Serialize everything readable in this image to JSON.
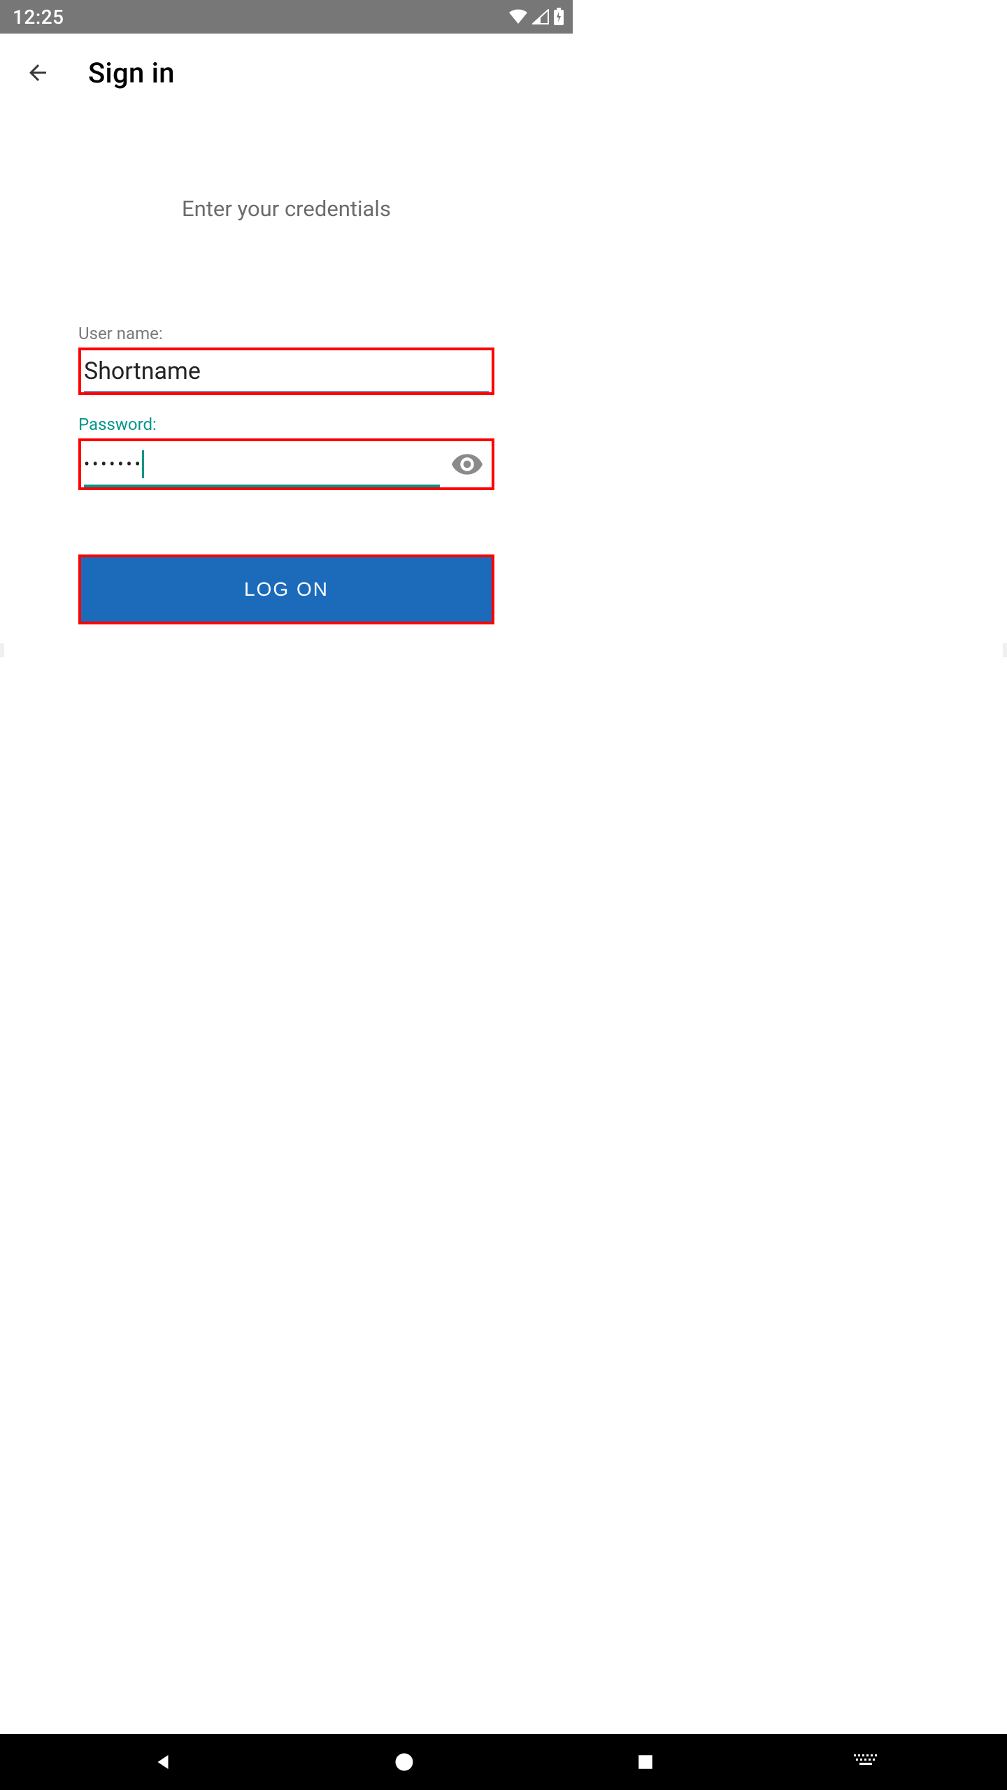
{
  "status": {
    "time": "12:25"
  },
  "appbar": {
    "title": "Sign in"
  },
  "main": {
    "subtitle": "Enter your credentials",
    "username_label": "User name:",
    "username_value": "Shortname",
    "password_label": "Password:",
    "password_masked": "•••••••",
    "logon_label": "LOG ON"
  },
  "colors": {
    "accent_teal": "#009688",
    "button_blue": "#1c6bba",
    "highlight_red": "#ff0000"
  }
}
